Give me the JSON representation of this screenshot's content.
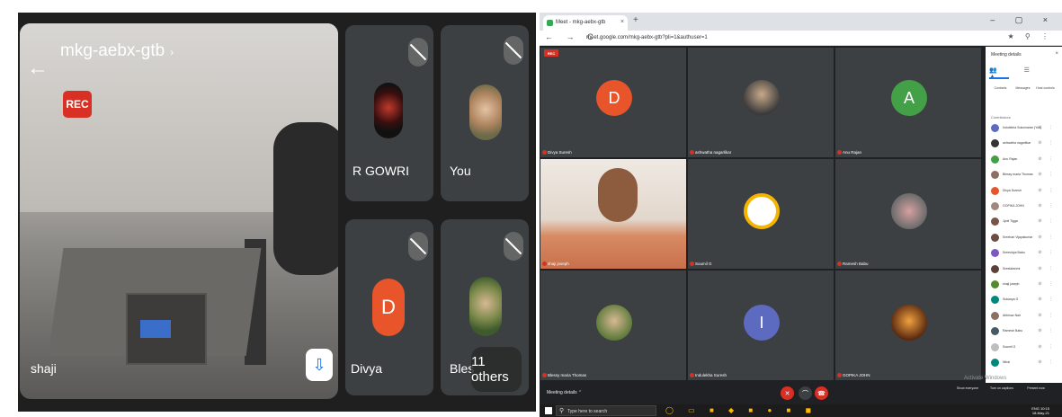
{
  "mobile": {
    "meeting_code": "mkg-aebx-gtb",
    "title_arrow": "›",
    "back": "←",
    "rec": "REC",
    "main_speaker": "shaji",
    "pin": "⇩",
    "cam_flip": "⟳",
    "speaker": "🔊",
    "tiles": [
      {
        "name": "R GOWRI"
      },
      {
        "name": "You"
      },
      {
        "name": "Divya",
        "letter": "D"
      },
      {
        "name": "Bles"
      }
    ],
    "others": "11 others"
  },
  "desktop": {
    "tab_title": "Meet - mkg-aebx-gtb",
    "tab_close": "×",
    "new_tab": "+",
    "window_controls": "– ▢ ×",
    "nav": "← → C",
    "url": "meet.google.com/mkg-aebx-gtb?pli=1&authuser=1",
    "url_tools": "★ ⚲ ⋮",
    "rec": "REC",
    "tiles": [
      {
        "name": "Divya Suresh",
        "letter": "D",
        "color": "#e8552b"
      },
      {
        "name": "ashwatha nagarlikar",
        "letter": ""
      },
      {
        "name": "Anu Rajan",
        "letter": "A",
        "color": "#43a047"
      },
      {
        "name": "shaji joseph",
        "letter": ""
      },
      {
        "name": "Soumil G",
        "letter": ""
      },
      {
        "name": "Ramesh Babu",
        "letter": ""
      },
      {
        "name": "Blessy maria Thomas",
        "letter": ""
      },
      {
        "name": "Indulekha Suresh",
        "letter": "I",
        "color": "#5c6bc0"
      },
      {
        "name": "GOPIKA JOHN",
        "letter": ""
      }
    ],
    "side_panel": {
      "title": "Meeting details",
      "close": "×",
      "tabs": "👥 ☰ ▲",
      "actions": [
        "Contacts",
        "Messages",
        "Host controls"
      ],
      "section": "Contributors",
      "participants": [
        {
          "name": "Indulekha Sukumaran (You)",
          "color": "#5c6bc0"
        },
        {
          "name": "ashwatha nagarlikar",
          "color": "#333333"
        },
        {
          "name": "Anu Rajan",
          "color": "#43a047"
        },
        {
          "name": "Blessy maria Thomas",
          "color": "#8d6e63"
        },
        {
          "name": "Divya Suresh",
          "color": "#e8552b"
        },
        {
          "name": "GOPIKA JOHN",
          "color": "#a1887f"
        },
        {
          "name": "Jyoti Tigga",
          "color": "#795548"
        },
        {
          "name": "Sreehari Vijayakumar",
          "color": "#6d4c41"
        },
        {
          "name": "Sreevidya Babu",
          "color": "#7e57c2"
        },
        {
          "name": "Sreelakshmi",
          "color": "#5d4037"
        },
        {
          "name": "shaji joseph",
          "color": "#558b2f"
        },
        {
          "name": "Sukanya G",
          "color": "#00897b"
        },
        {
          "name": "Abhinav Nair",
          "color": "#8d6e63"
        },
        {
          "name": "Ramesh Babu",
          "color": "#455a64"
        },
        {
          "name": "Soumil G",
          "color": "#bdbdbd"
        },
        {
          "name": "Nihal",
          "color": "#00897b"
        }
      ]
    },
    "bottom": {
      "details": "Meeting details ⌃",
      "right": [
        "Show everyone",
        "Turn on captions",
        "Present now"
      ]
    },
    "activate": "Activate Windows",
    "taskbar": {
      "search": "Type here to search",
      "icons": "◯ ▭ ■ ◆ ■ ● ■ ◼",
      "clock": "ENG 10:15\n18-May-21"
    }
  }
}
